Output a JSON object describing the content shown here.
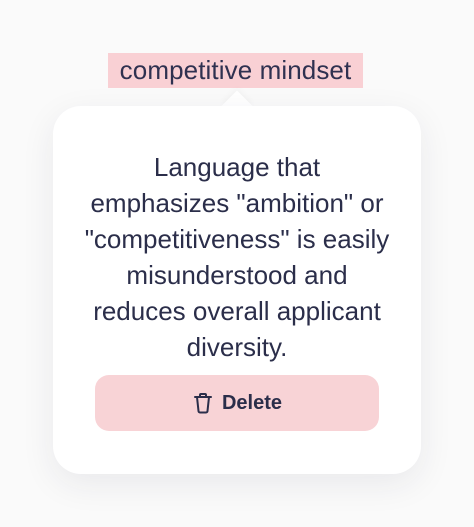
{
  "highlight": {
    "text": "competitive mindset",
    "color": "#f9d0d4"
  },
  "card": {
    "message": "Language that emphasizes \"ambition\" or \"competitiveness\" is easily misunderstood and reduces overall applicant diversity.",
    "delete_button": {
      "label": "Delete",
      "icon": "trash-icon",
      "color": "#f8d3d6"
    }
  }
}
